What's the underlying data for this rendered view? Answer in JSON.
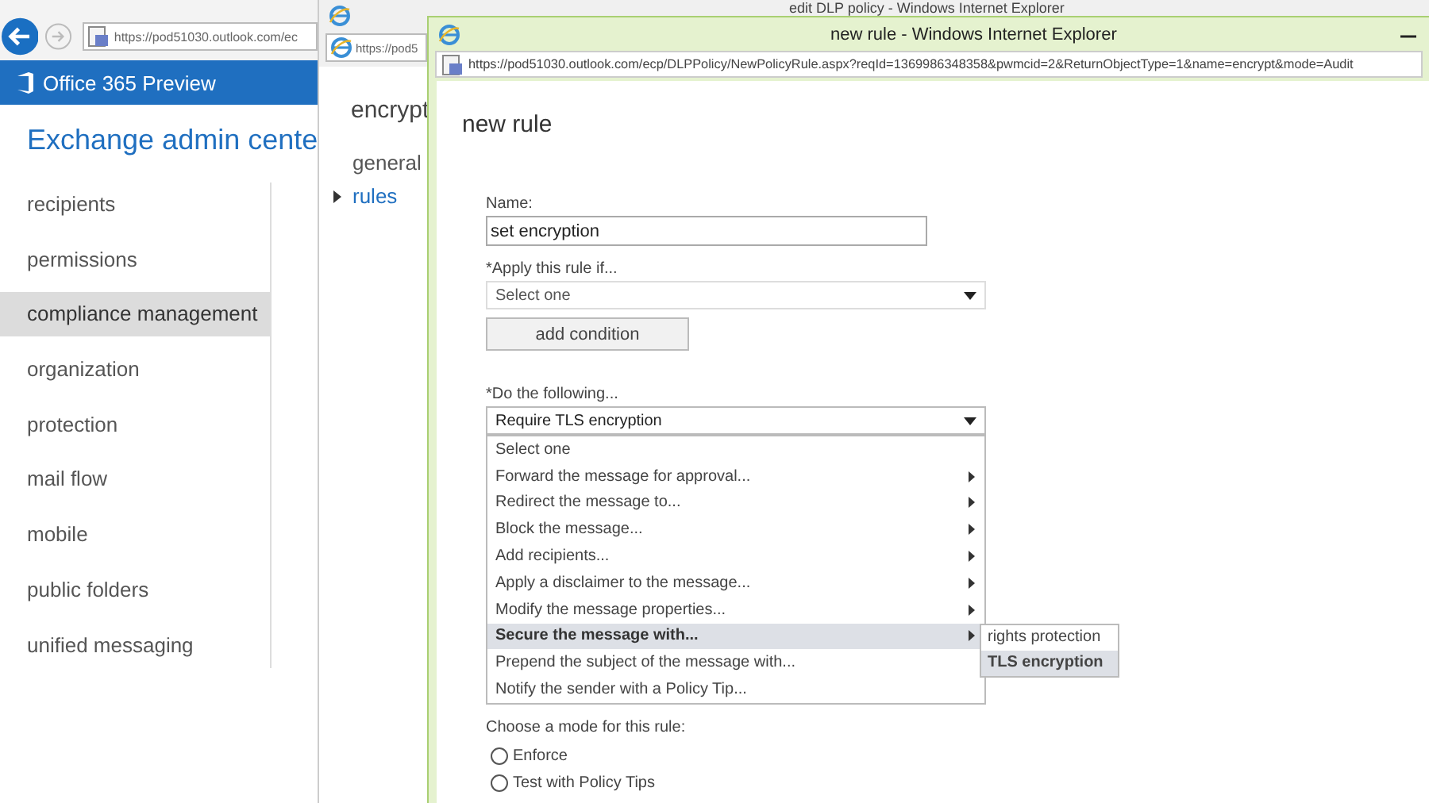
{
  "admin_window": {
    "address": "https://pod51030.outlook.com/ec",
    "brand": "Office 365 Preview",
    "heading": "Exchange admin cente",
    "nav": [
      {
        "label": "recipients",
        "selected": false
      },
      {
        "label": "permissions",
        "selected": false
      },
      {
        "label": "compliance management",
        "selected": true
      },
      {
        "label": "organization",
        "selected": false
      },
      {
        "label": "protection",
        "selected": false
      },
      {
        "label": "mail flow",
        "selected": false
      },
      {
        "label": "mobile",
        "selected": false
      },
      {
        "label": "public folders",
        "selected": false
      },
      {
        "label": "unified messaging",
        "selected": false
      }
    ]
  },
  "policy_window": {
    "title": "edit DLP policy - Windows Internet Explorer",
    "address": "https://pod5",
    "heading": "encrypt",
    "sections": [
      {
        "label": "general",
        "selected": false
      },
      {
        "label": "rules",
        "selected": true
      }
    ]
  },
  "rule_dialog": {
    "title": "new rule - Windows Internet Explorer",
    "address": "https://pod51030.outlook.com/ecp/DLPPolicy/NewPolicyRule.aspx?reqId=1369986348358&pwmcid=2&ReturnObjectType=1&name=encrypt&mode=Audit",
    "heading": "new rule",
    "name_label": "Name:",
    "name_value": "set encryption",
    "condition": {
      "label": "*Apply this rule if...",
      "value": "Select one",
      "button": "add condition"
    },
    "action": {
      "label": "*Do the following...",
      "value": "Require TLS encryption",
      "expanded": true,
      "options": [
        {
          "label": "Select one",
          "selected": false,
          "submenu": false
        },
        {
          "label": "Forward the message for approval...",
          "selected": false,
          "submenu": true
        },
        {
          "label": "Redirect the message to...",
          "selected": false,
          "submenu": true
        },
        {
          "label": "Block the message...",
          "selected": false,
          "submenu": true
        },
        {
          "label": "Add recipients...",
          "selected": false,
          "submenu": true
        },
        {
          "label": "Apply a disclaimer to the message...",
          "selected": false,
          "submenu": true
        },
        {
          "label": "Modify the message properties...",
          "selected": false,
          "submenu": true
        },
        {
          "label": "Secure the message with...",
          "selected": true,
          "submenu": true
        },
        {
          "label": "Prepend the subject of the message with...",
          "selected": false,
          "submenu": false
        },
        {
          "label": "Notify the sender with a Policy Tip...",
          "selected": false,
          "submenu": false
        }
      ],
      "submenu_items": [
        {
          "label": "rights protection",
          "selected": false
        },
        {
          "label": "TLS encryption",
          "selected": true
        }
      ]
    },
    "mode": {
      "label": "Choose a mode for this rule:",
      "options": [
        {
          "label": "Enforce",
          "selected": false
        },
        {
          "label": "Test with Policy Tips",
          "selected": false
        }
      ]
    }
  }
}
